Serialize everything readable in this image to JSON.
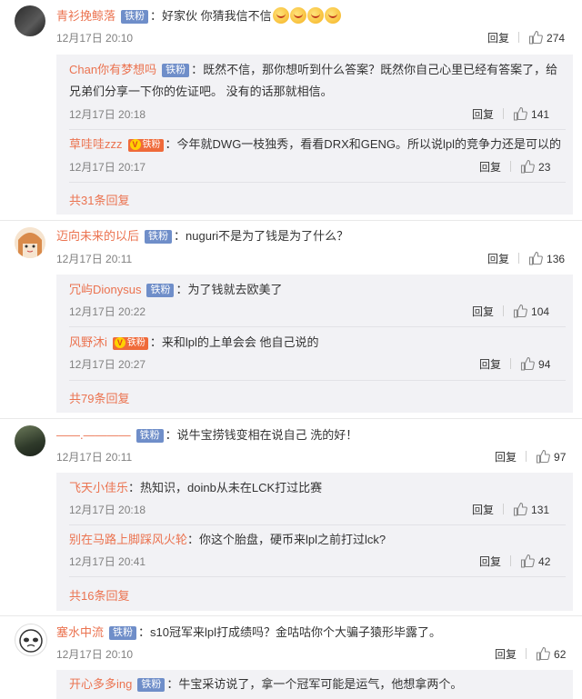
{
  "badge_label": "铁粉",
  "vip_label": "铁粉",
  "reply_label": "回复",
  "threads": [
    {
      "author": "青衫挽鲸落",
      "text": "好家伙   你猜我信不信",
      "emoji_count": 4,
      "time": "12月17日 20:10",
      "likes": "274",
      "replies": [
        {
          "author": "Chan你有梦想吗",
          "badge": "badge",
          "text_line1": "既然不信，那你想听到什么答案？既然你自己心里已经有答案了，给",
          "text_line2": "兄弟们分享一下你的佐证吧。 没有的话那就相信。",
          "time": "12月17日 20:18",
          "likes": "141"
        },
        {
          "author": "草哇哇zzz",
          "badge": "vip",
          "text_line1": "今年就DWG一枝独秀，看看DRX和GENG。所以说lpl的竞争力还是可以的",
          "time": "12月17日 20:17",
          "likes": "23"
        }
      ],
      "more": "共31条回复"
    },
    {
      "author": "迈向未来的以后",
      "text": "nuguri不是为了钱是为了什么？",
      "time": "12月17日 20:11",
      "likes": "136",
      "replies": [
        {
          "author": "冗屿Dionysus",
          "badge": "badge",
          "text_line1": "为了钱就去欧美了",
          "time": "12月17日 20:22",
          "likes": "104"
        },
        {
          "author": "风野沐i",
          "badge": "vip",
          "text_line1": "来和lpl的上单会会 他自己说的",
          "time": "12月17日 20:27",
          "likes": "94"
        }
      ],
      "more": "共79条回复"
    },
    {
      "author": "——.————",
      "text": "说牛宝捞钱变相在说自己 洗的好！",
      "time": "12月17日 20:11",
      "likes": "97",
      "replies": [
        {
          "author": "飞天小佳乐",
          "badge": "none",
          "text_line1": "热知识，doinb从未在LCK打过比赛",
          "time": "12月17日 20:18",
          "likes": "131"
        },
        {
          "author": "别在马路上脚踩风火轮",
          "badge": "none",
          "text_line1": "你这个胎盘，硬币来lpl之前打过lck?",
          "time": "12月17日 20:41",
          "likes": "42"
        }
      ],
      "more": "共16条回复"
    },
    {
      "author": "塞水中流",
      "text": "s10冠军来lpl打成绩吗？金咕咕你个大骗子猿形毕露了。",
      "time": "12月17日 20:10",
      "likes": "62",
      "replies": [
        {
          "author": "开心多多ing",
          "badge": "badge",
          "text_line1": "牛宝采访说了，拿一个冠军可能是运气，他想拿两个。"
        }
      ]
    }
  ]
}
